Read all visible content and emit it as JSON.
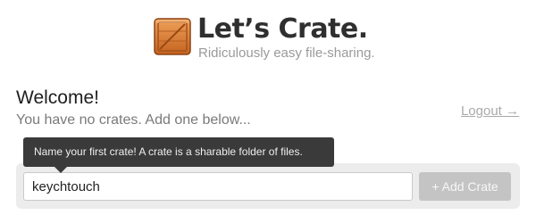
{
  "brand": {
    "name": "Let’s Crate.",
    "tagline": "Ridiculously easy file-sharing.",
    "logo_icon": "crate-icon",
    "colors": {
      "wood_light": "#e08a45",
      "wood_dark": "#a84f1d",
      "title": "#2f2f2f",
      "tagline": "#9a9a9a"
    }
  },
  "welcome": {
    "title": "Welcome!",
    "subtitle": "You have no crates. Add one below..."
  },
  "nav": {
    "logout_label": "Logout →"
  },
  "tooltip": {
    "text": "Name your first crate! A crate is a sharable folder of files."
  },
  "form": {
    "input_value": "keychtouch",
    "add_button_label": "+ Add Crate"
  }
}
